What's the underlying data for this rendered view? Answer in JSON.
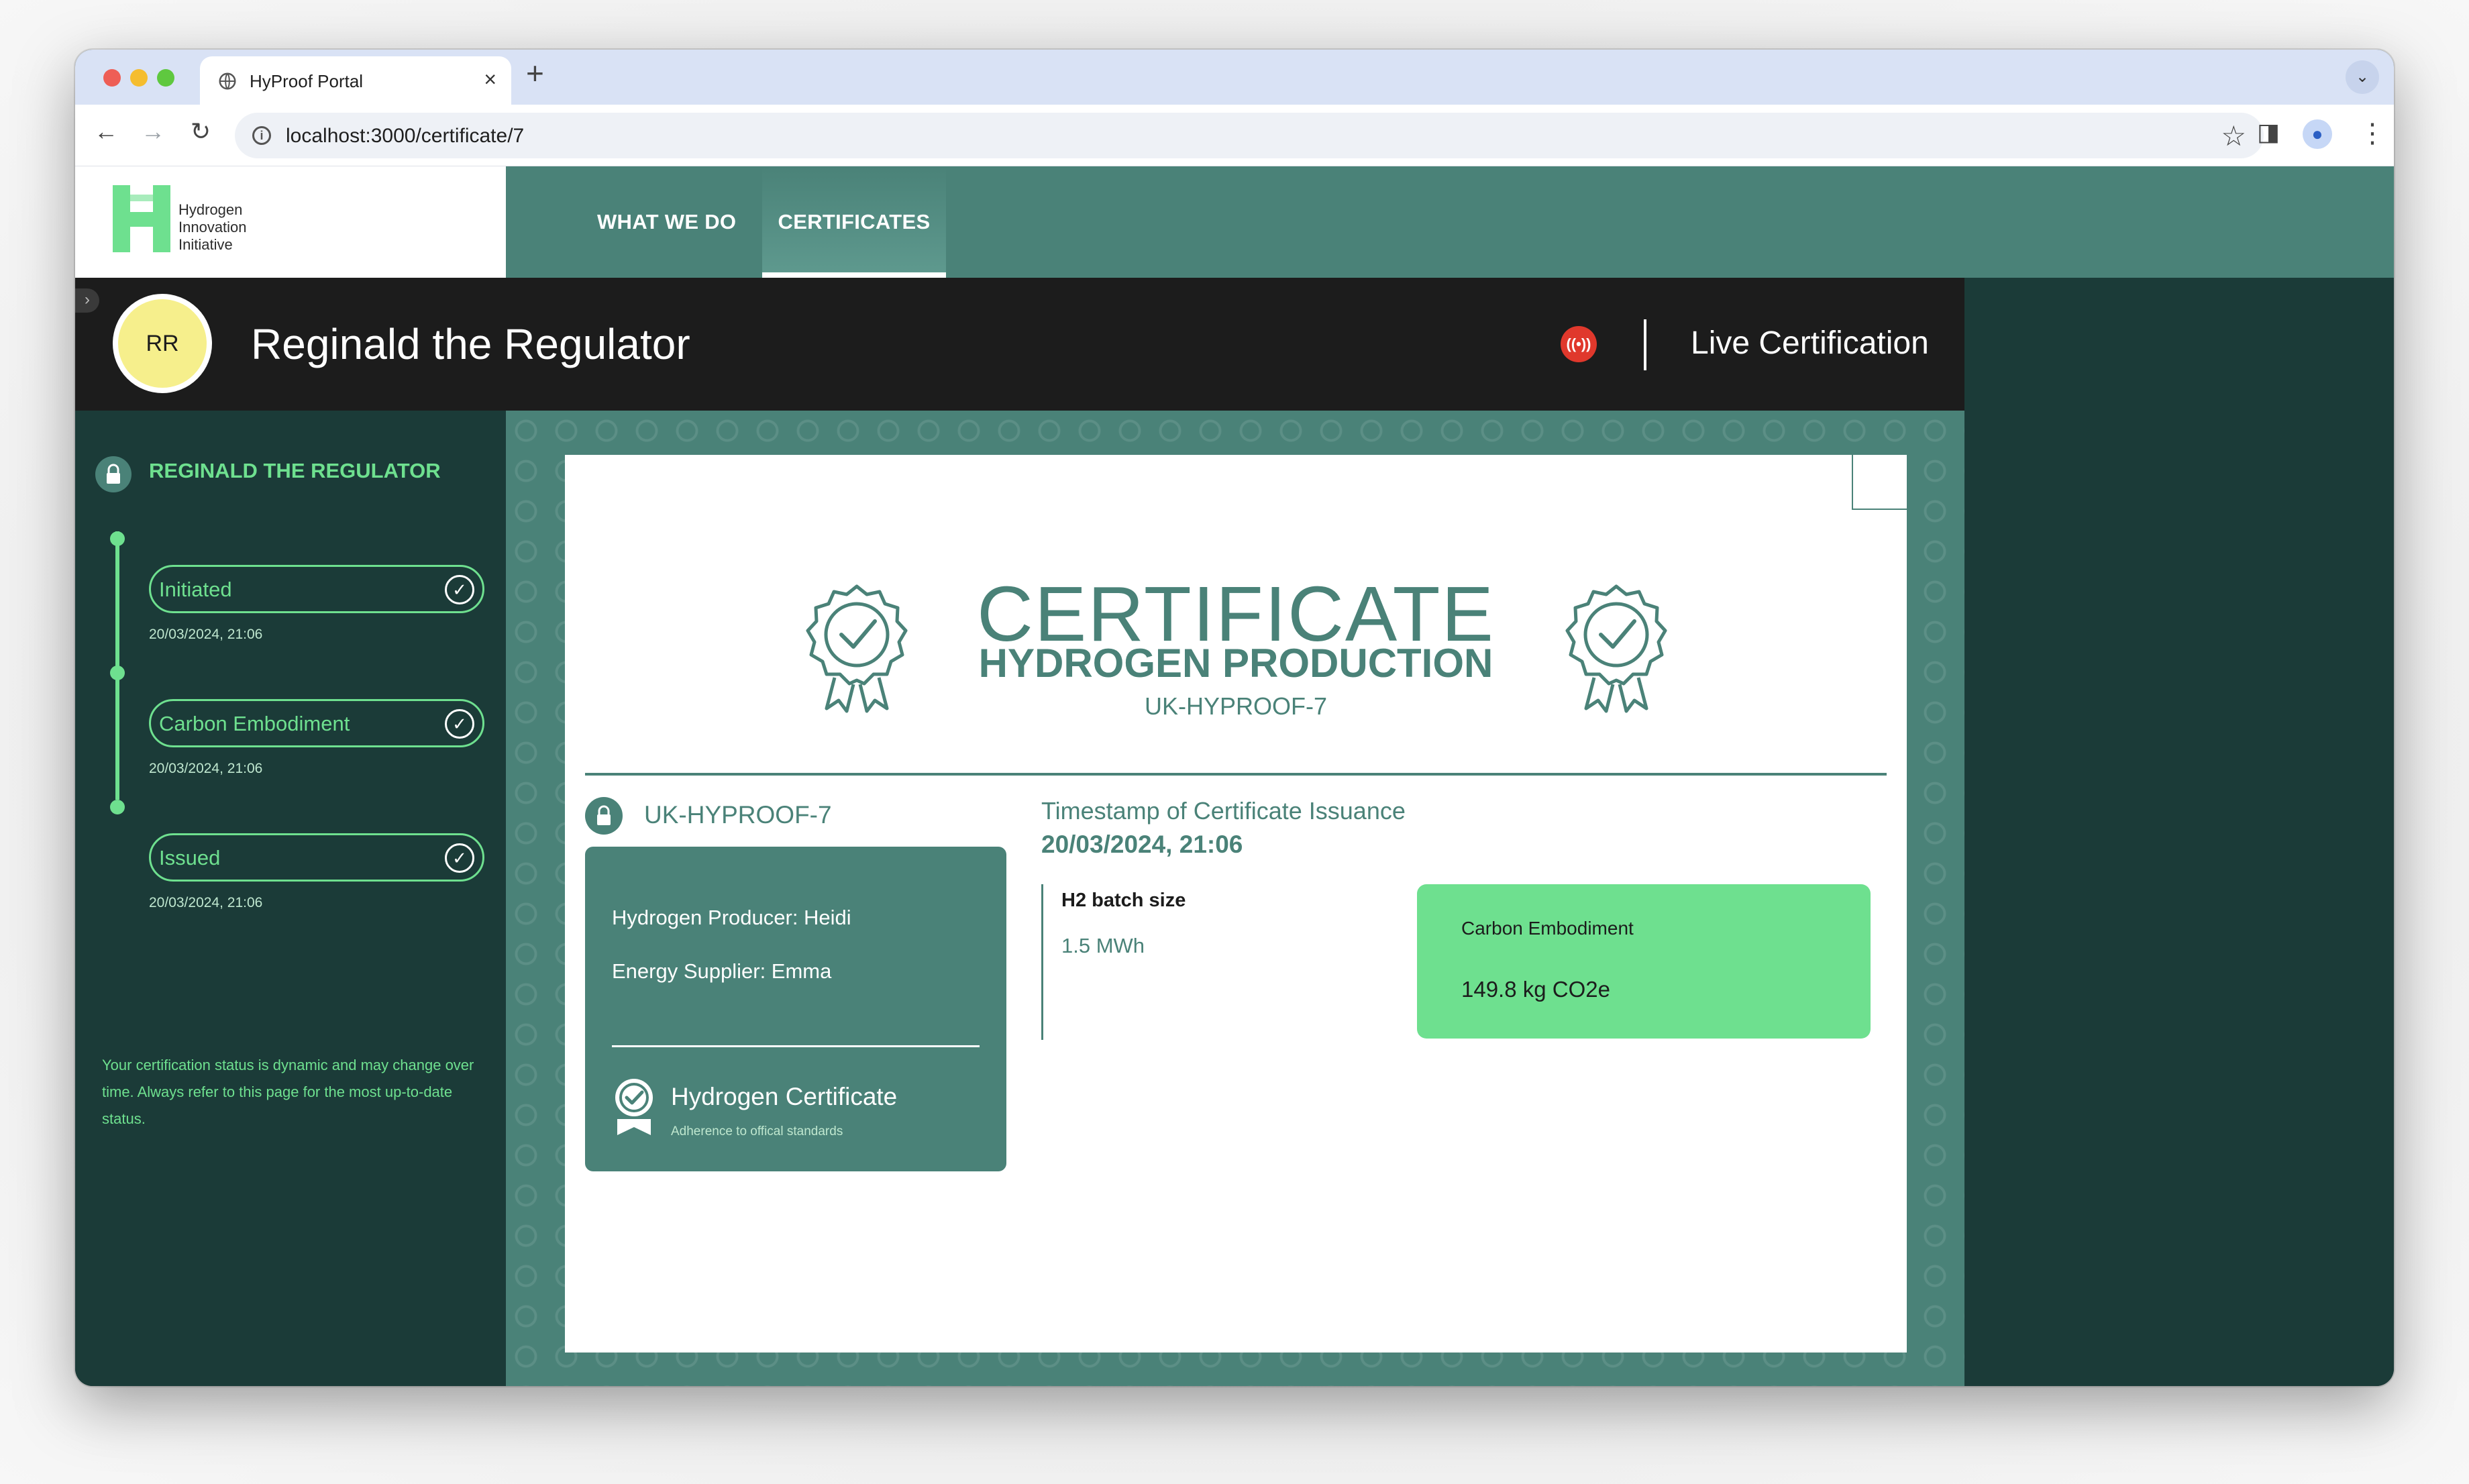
{
  "browser": {
    "tab_title": "HyProof Portal",
    "url": "localhost:3000/certificate/7",
    "new_tab_label": "+",
    "close_label": "×"
  },
  "site": {
    "logo_lines": [
      "Hydrogen",
      "Innovation",
      "Initiative"
    ],
    "nav": [
      {
        "label": "WHAT WE DO",
        "active": false
      },
      {
        "label": "CERTIFICATES",
        "active": true
      }
    ]
  },
  "user": {
    "initials": "RR",
    "name": "Reginald the Regulator",
    "live_label": "Live Certification"
  },
  "sidebar": {
    "heading": "REGINALD THE REGULATOR",
    "steps": [
      {
        "label": "Initiated",
        "date": "20/03/2024, 21:06"
      },
      {
        "label": "Carbon Embodiment",
        "date": "20/03/2024, 21:06"
      },
      {
        "label": "Issued",
        "date": "20/03/2024, 21:06"
      }
    ],
    "note": "Your certification status is dynamic and may change over time. Always refer to this page for the most up-to-date status."
  },
  "certificate": {
    "title": "CERTIFICATE",
    "subtitle": "HYDROGEN PRODUCTION",
    "code": "UK-HYPROOF-7",
    "id_code": "UK-HYPROOF-7",
    "producer": "Hydrogen Producer: Heidi",
    "supplier": "Energy Supplier: Emma",
    "cert_name": "Hydrogen Certificate",
    "cert_sub": "Adherence to offical standards",
    "timestamp_label": "Timestamp of Certificate Issuance",
    "timestamp_value": "20/03/2024, 21:06",
    "batch_label": "H2 batch size",
    "batch_value": "1.5 MWh",
    "carbon_label": "Carbon Embodiment",
    "carbon_value": "149.8 kg CO2e"
  },
  "colors": {
    "primary": "#4a8278",
    "accent": "#6ee08f",
    "dark": "#1b3b38",
    "live": "#e0382c"
  }
}
